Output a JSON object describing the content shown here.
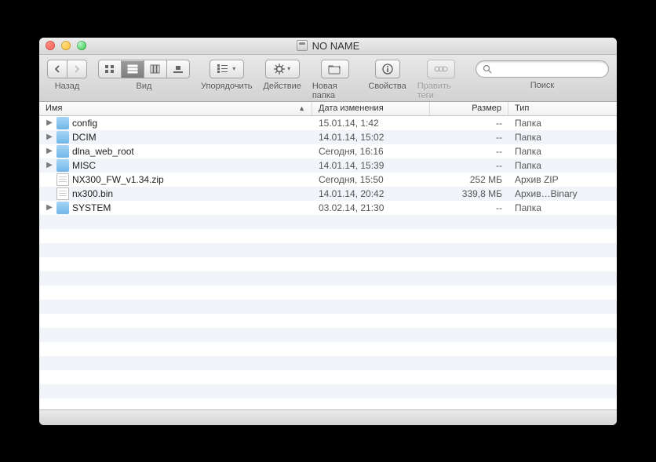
{
  "window": {
    "title": "NO NAME"
  },
  "toolbar": {
    "back_label": "Назад",
    "view_label": "Вид",
    "arrange_label": "Упорядочить",
    "action_label": "Действие",
    "newfolder_label": "Новая папка",
    "info_label": "Свойства",
    "tags_label": "Править теги",
    "search_label": "Поиск",
    "search_placeholder": ""
  },
  "columns": {
    "name": "Имя",
    "date": "Дата изменения",
    "size": "Размер",
    "type": "Тип"
  },
  "rows": [
    {
      "expandable": true,
      "icon": "folder",
      "name": "config",
      "date": "15.01.14, 1:42",
      "size": "--",
      "type": "Папка"
    },
    {
      "expandable": true,
      "icon": "folder",
      "name": "DCIM",
      "date": "14.01.14, 15:02",
      "size": "--",
      "type": "Папка"
    },
    {
      "expandable": true,
      "icon": "folder",
      "name": "dlna_web_root",
      "date": "Сегодня, 16:16",
      "size": "--",
      "type": "Папка"
    },
    {
      "expandable": true,
      "icon": "folder",
      "name": "MISC",
      "date": "14.01.14, 15:39",
      "size": "--",
      "type": "Папка"
    },
    {
      "expandable": false,
      "icon": "file",
      "name": "NX300_FW_v1.34.zip",
      "date": "Сегодня, 15:50",
      "size": "252 МБ",
      "type": "Архив ZIP"
    },
    {
      "expandable": false,
      "icon": "file",
      "name": "nx300.bin",
      "date": "14.01.14, 20:42",
      "size": "339,8 МБ",
      "type": "Архив…Binary"
    },
    {
      "expandable": true,
      "icon": "folder",
      "name": "SYSTEM",
      "date": "03.02.14, 21:30",
      "size": "--",
      "type": "Папка"
    }
  ]
}
